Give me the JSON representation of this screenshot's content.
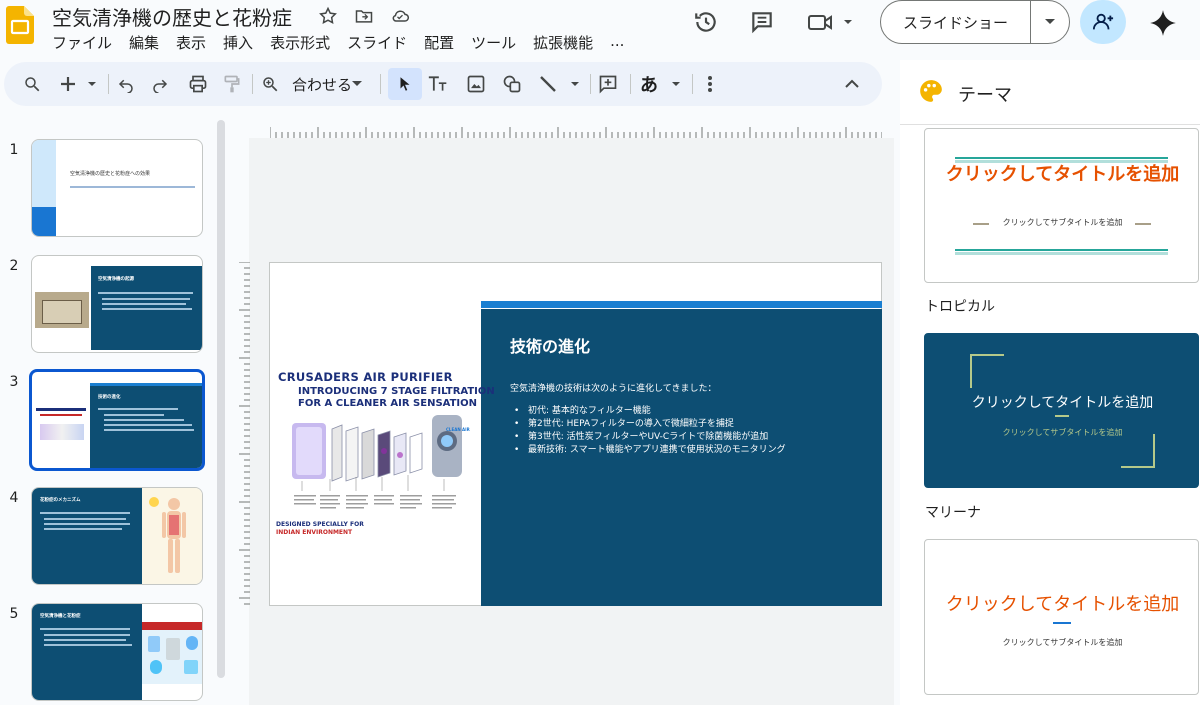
{
  "header": {
    "doc_title": "空気清浄機の歴史と花粉症",
    "menu": [
      "ファイル",
      "編集",
      "表示",
      "挿入",
      "表示形式",
      "スライド",
      "配置",
      "ツール",
      "拡張機能",
      "..."
    ],
    "slideshow_label": "スライドショー",
    "icons": [
      "star-icon",
      "move-folder-icon",
      "cloud-status-icon",
      "history-icon",
      "comments-icon",
      "video-call-icon",
      "add-person-icon",
      "gemini-sparkle-icon"
    ]
  },
  "toolbar": {
    "zoom_label": "合わせる"
  },
  "filmstrip": {
    "slides": [
      {
        "num": "1",
        "title": "空気清浄機の歴史と花粉症への効果"
      },
      {
        "num": "2",
        "title": "空気清浄機の起源"
      },
      {
        "num": "3",
        "title": "技術の進化"
      },
      {
        "num": "4",
        "title": "花粉症のメカニズム"
      },
      {
        "num": "5",
        "title": "空気清浄機と花粉症"
      }
    ],
    "selected_index": 2
  },
  "slide": {
    "title": "技術の進化",
    "intro": "空気清浄機の技術は次のように進化してきました：",
    "bullets": [
      "初代: 基本的なフィルター機能",
      "第2世代: HEPAフィルターの導入で微細粒子を捕捉",
      "第3世代: 活性炭フィルターやUV-Cライトで除菌機能が追加",
      "最新技術: スマート機能やアプリ連携で使用状況のモニタリング"
    ],
    "image": {
      "heading": "CRUSADERS AIR PURIFIER",
      "line2": "INTRODUCING 7 STAGE FILTRATION",
      "line3": "FOR A CLEANER AIR SENSATION",
      "clean_air": "CLEAN AIR",
      "footer1": "DESIGNED SPECIALLY FOR",
      "footer2": "INDIAN ENVIRONMENT"
    }
  },
  "theme_panel": {
    "title": "テーマ",
    "themes": [
      {
        "name": "",
        "title": "クリックしてタイトルを追加",
        "subtitle": "クリックしてサブタイトルを追加"
      },
      {
        "name": "トロピカル",
        "title": "クリックしてタイトルを追加",
        "subtitle": "クリックしてサブタイトルを追加"
      },
      {
        "name": "マリーナ",
        "title": "クリックしてタイトルを追加",
        "subtitle": "クリックしてサブタイトルを追加"
      }
    ]
  }
}
